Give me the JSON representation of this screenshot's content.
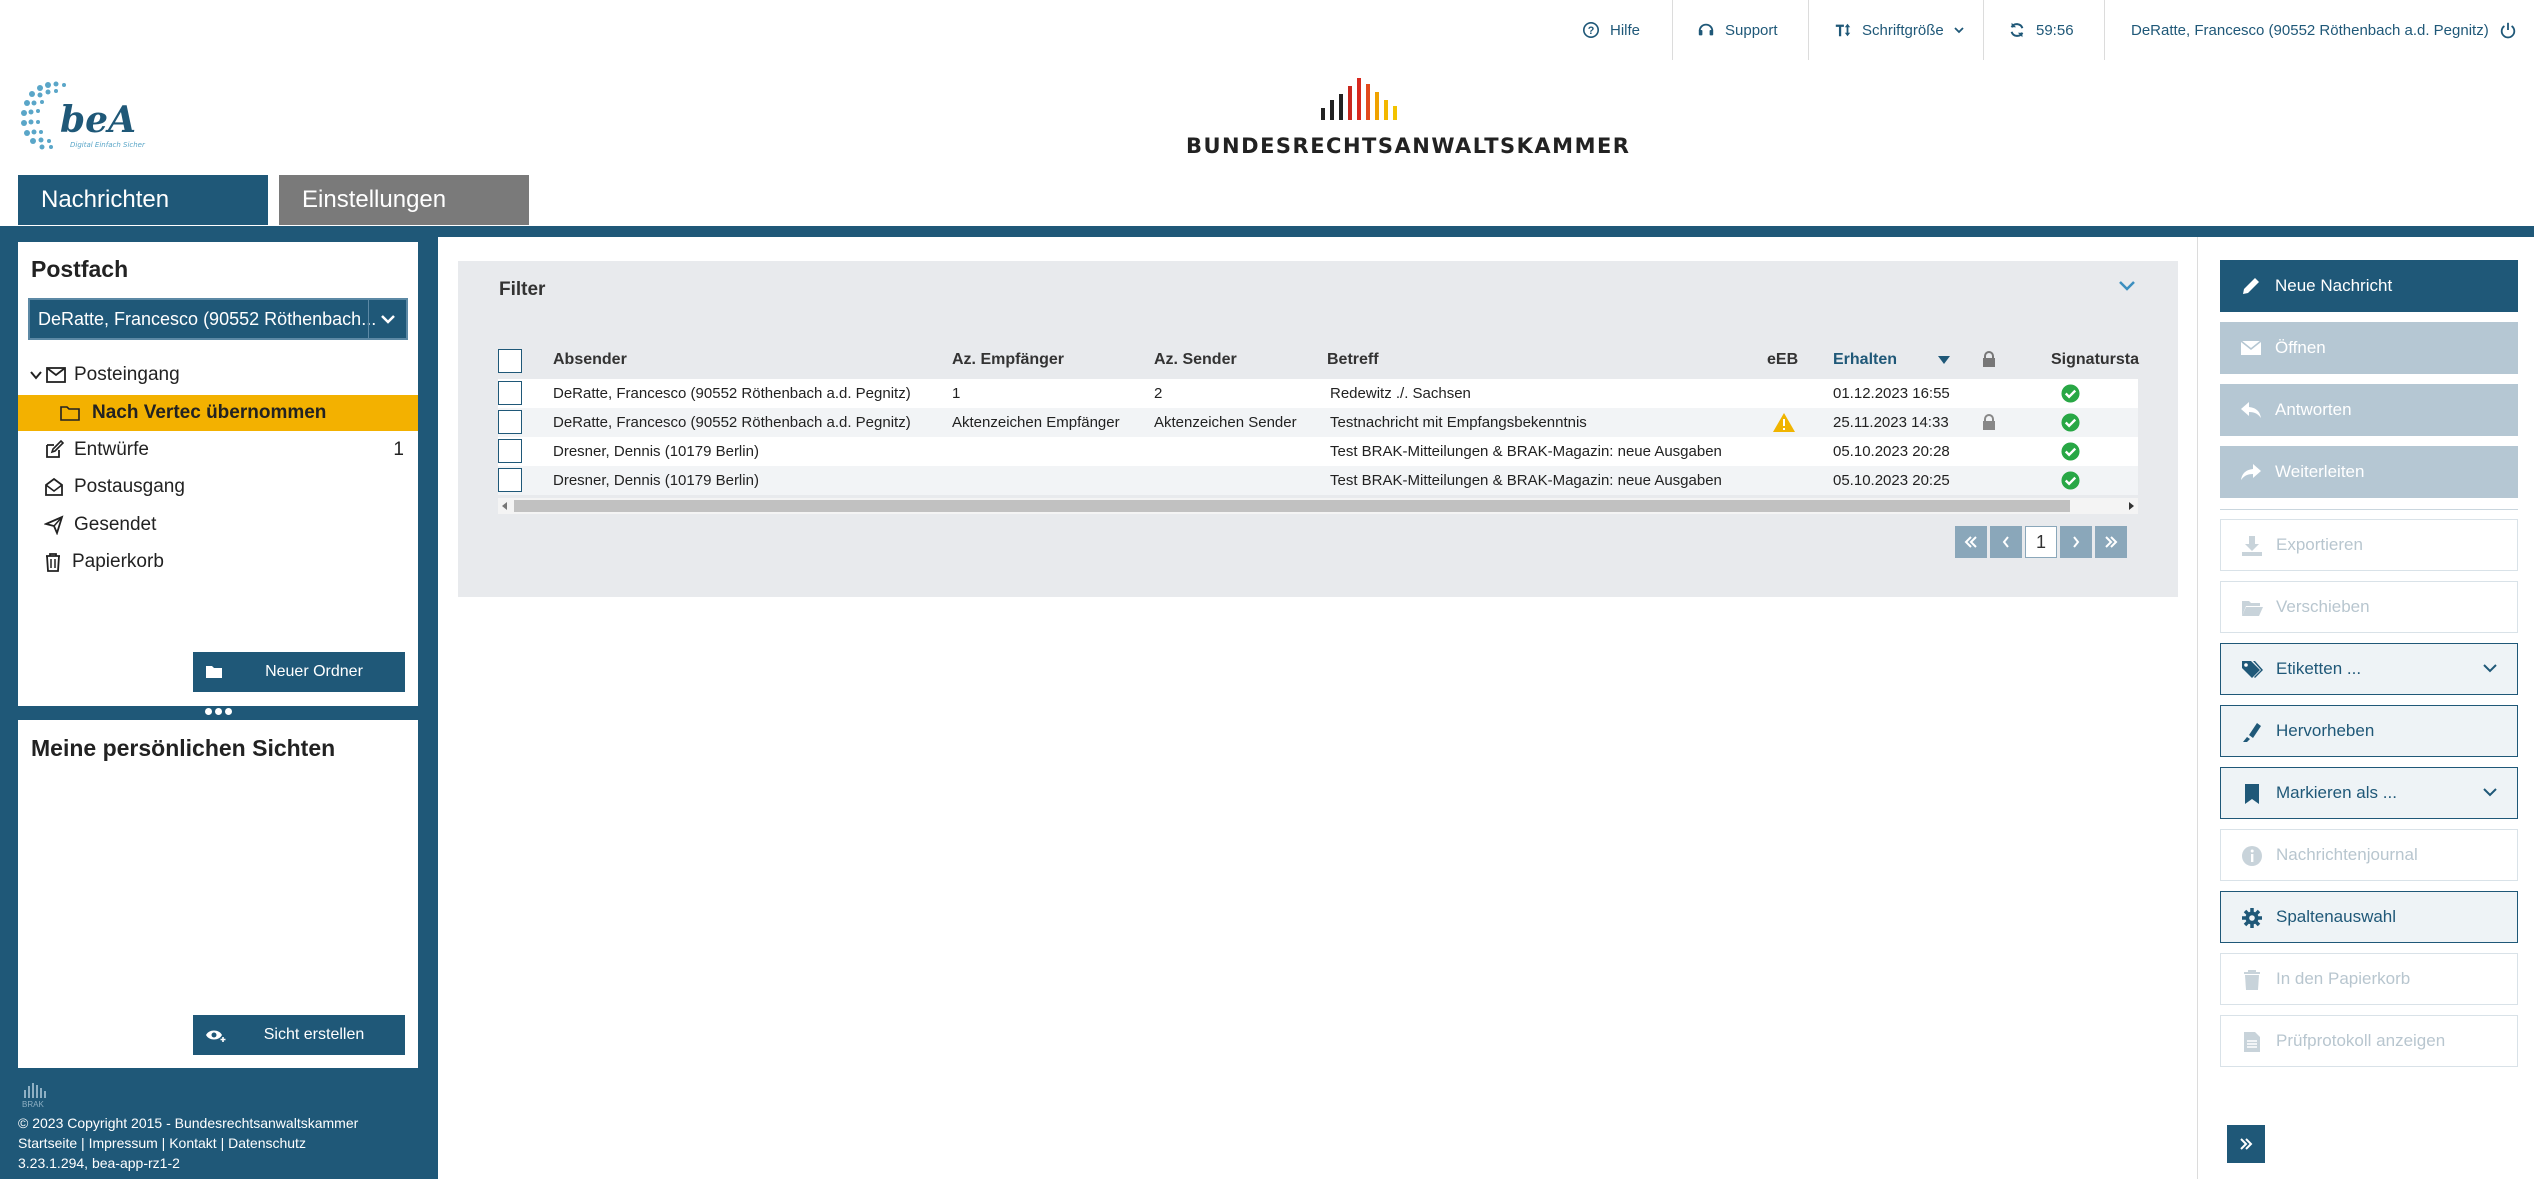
{
  "topbar": {
    "help": "Hilfe",
    "support": "Support",
    "font_size": "Schriftgröße",
    "session_timer": "59:56",
    "user": "DeRatte, Francesco (90552 Röthenbach a.d. Pegnitz)"
  },
  "header": {
    "bea_logo_text": "beA",
    "bea_tagline": "Digital Einfach Sicher",
    "brak_title": "BUNDESRECHTSANWALTSKAMMER"
  },
  "tabs": {
    "messages": "Nachrichten",
    "settings": "Einstellungen"
  },
  "postfach": {
    "title": "Postfach",
    "selected_mailbox": "DeRatte, Francesco (90552 Röthenbach...",
    "folders": [
      {
        "label": "Posteingang",
        "count": ""
      },
      {
        "label": "Nach Vertec übernommen",
        "count": ""
      },
      {
        "label": "Entwürfe",
        "count": "1"
      },
      {
        "label": "Postausgang",
        "count": ""
      },
      {
        "label": "Gesendet",
        "count": ""
      },
      {
        "label": "Papierkorb",
        "count": ""
      }
    ],
    "new_folder": "Neuer Ordner"
  },
  "sichten": {
    "title": "Meine persönlichen Sichten",
    "create_view": "Sicht erstellen"
  },
  "footer": {
    "brak_small": "BRAK",
    "copyright": "© 2023 Copyright 2015 - Bundesrechtsanwaltskammer",
    "links": [
      "Startseite",
      "Impressum",
      "Kontakt",
      "Datenschutz"
    ],
    "version": "3.23.1.294, bea-app-rz1-2"
  },
  "filter": {
    "title": "Filter"
  },
  "grid": {
    "columns": [
      "Absender",
      "Az. Empfänger",
      "Az. Sender",
      "Betreff",
      "eEB",
      "Erhalten",
      "Signatursta"
    ],
    "rows": [
      {
        "absender": "DeRatte, Francesco (90552 Röthenbach a.d. Pegnitz)",
        "az_empfaenger": "1",
        "az_sender": "2",
        "betreff": "Redewitz ./. Sachsen",
        "eeb_warning": false,
        "erhalten": "01.12.2023 16:55",
        "locked": false,
        "signature_ok": true
      },
      {
        "absender": "DeRatte, Francesco (90552 Röthenbach a.d. Pegnitz)",
        "az_empfaenger": "Aktenzeichen Empfänger",
        "az_sender": "Aktenzeichen Sender",
        "betreff": "Testnachricht mit Empfangsbekenntnis",
        "eeb_warning": true,
        "erhalten": "25.11.2023 14:33",
        "locked": true,
        "signature_ok": true
      },
      {
        "absender": "Dresner, Dennis (10179 Berlin)",
        "az_empfaenger": "",
        "az_sender": "",
        "betreff": "Test BRAK-Mitteilungen & BRAK-Magazin: neue Ausgaben",
        "eeb_warning": false,
        "erhalten": "05.10.2023 20:28",
        "locked": false,
        "signature_ok": true
      },
      {
        "absender": "Dresner, Dennis (10179 Berlin)",
        "az_empfaenger": "",
        "az_sender": "",
        "betreff": "Test BRAK-Mitteilungen & BRAK-Magazin: neue Ausgaben",
        "eeb_warning": false,
        "erhalten": "05.10.2023 20:25",
        "locked": false,
        "signature_ok": true
      }
    ],
    "current_page": "1"
  },
  "actions": {
    "new_message": "Neue Nachricht",
    "open": "Öffnen",
    "reply": "Antworten",
    "forward": "Weiterleiten",
    "export": "Exportieren",
    "move": "Verschieben",
    "labels": "Etiketten ...",
    "highlight": "Hervorheben",
    "mark_as": "Markieren als ...",
    "journal": "Nachrichtenjournal",
    "columns": "Spaltenauswahl",
    "trash": "In den Papierkorb",
    "protocol": "Prüfprotokoll anzeigen"
  },
  "colors": {
    "brand": "#1f5878",
    "highlight": "#f3b100",
    "grid_bg": "#e8eaed",
    "success": "#28a745",
    "warning": "#f0b400"
  }
}
